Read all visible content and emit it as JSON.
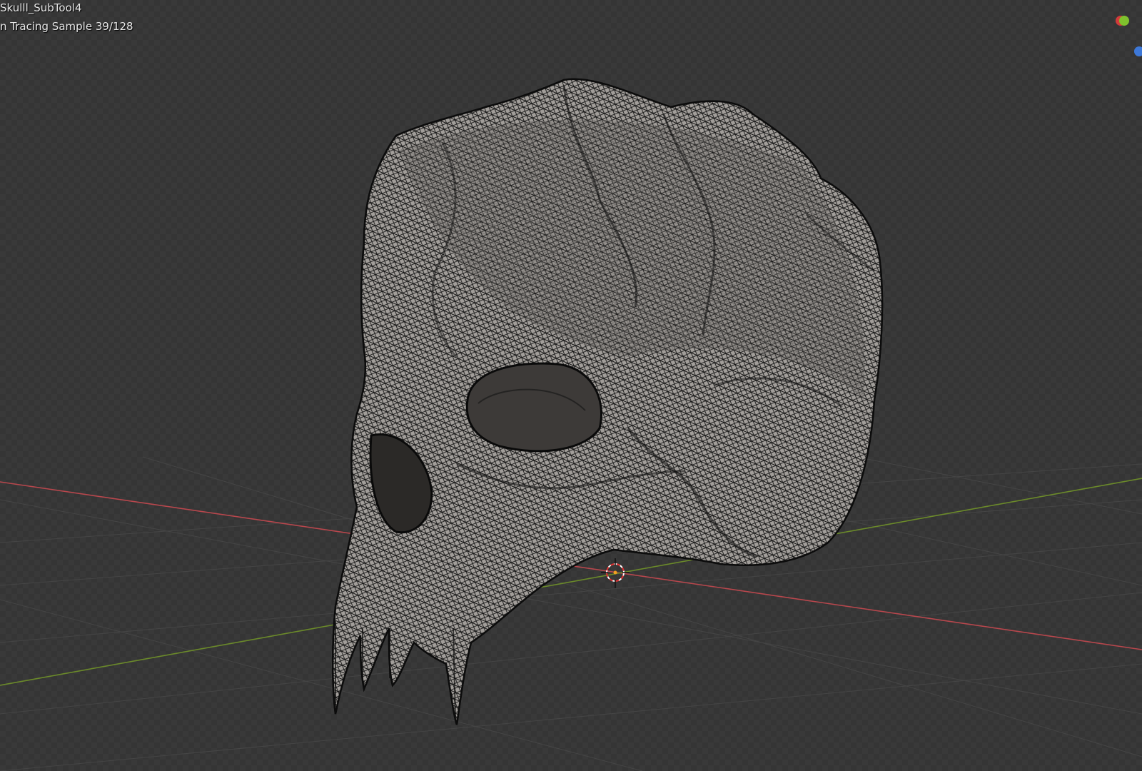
{
  "viewport": {
    "object_name": "Skulll_SubTool4",
    "render_status": "n Tracing Sample 39/128",
    "colors": {
      "background": "#393939",
      "x_axis": "#b8474d",
      "y_axis": "#6b8a2a",
      "grid": "#454545",
      "mesh_fill": "#a8a4a0",
      "mesh_wire": "#151515",
      "cursor_red": "#e23030"
    }
  },
  "gizmo": {
    "axes": [
      "x-axis-red",
      "y-axis-green",
      "z-axis-blue"
    ]
  }
}
